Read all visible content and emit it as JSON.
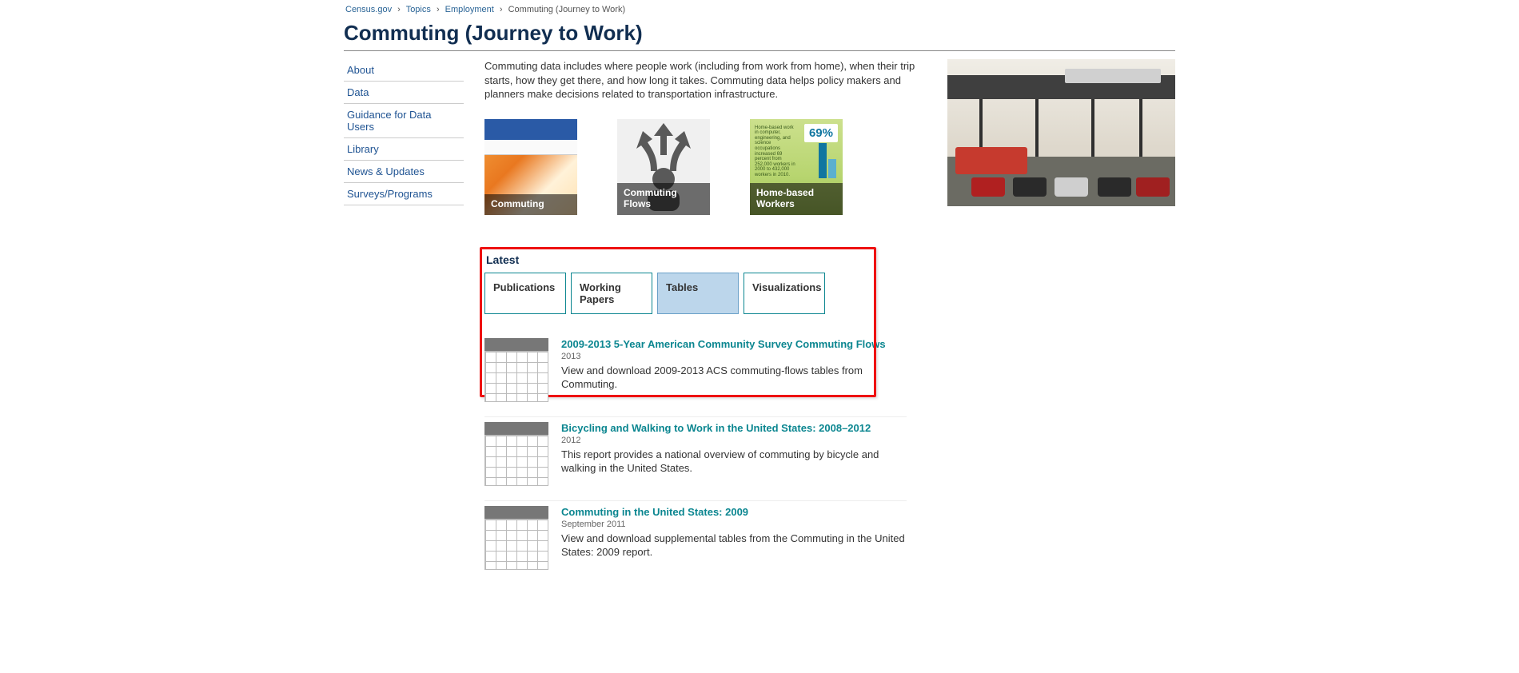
{
  "breadcrumb": [
    {
      "label": "Census.gov"
    },
    {
      "label": "Topics"
    },
    {
      "label": "Employment"
    },
    {
      "label": "Commuting (Journey to Work)"
    }
  ],
  "page_title": "Commuting (Journey to Work)",
  "sidebar": [
    {
      "label": "About"
    },
    {
      "label": "Data"
    },
    {
      "label": "Guidance for Data Users"
    },
    {
      "label": "Library"
    },
    {
      "label": "News & Updates"
    },
    {
      "label": "Surveys/Programs"
    }
  ],
  "intro": "Commuting data includes where people work (including from work from home), when their trip starts, how they get there, and how long it takes. Commuting data helps policy makers and planners make decisions related to transportation infrastructure.",
  "cards": [
    {
      "label": "Commuting"
    },
    {
      "label": "Commuting Flows"
    },
    {
      "label": "Home-based Workers",
      "stat": "69%",
      "note": "Home-based work in computer, engineering, and science occupations increased 69 percent from 252,000 workers in 2000 to 432,000 workers in 2010."
    }
  ],
  "latest": {
    "title": "Latest",
    "tabs": [
      {
        "label": "Publications",
        "active": false
      },
      {
        "label": "Working Papers",
        "active": false
      },
      {
        "label": "Tables",
        "active": true
      },
      {
        "label": "Visualizations",
        "active": false
      }
    ],
    "items": [
      {
        "title": "2009-2013 5-Year American Community Survey Commuting Flows",
        "date": "2013",
        "desc": "View and download 2009-2013 ACS commuting-flows tables from Commuting."
      },
      {
        "title": "Bicycling and Walking to Work in the United States: 2008–2012",
        "date": "2012",
        "desc": "This report provides a national overview of commuting by bicycle and walking in the United States."
      },
      {
        "title": "Commuting in the United States: 2009",
        "date": "September 2011",
        "desc": "View and download supplemental tables from the Commuting in the United States: 2009 report."
      }
    ]
  }
}
